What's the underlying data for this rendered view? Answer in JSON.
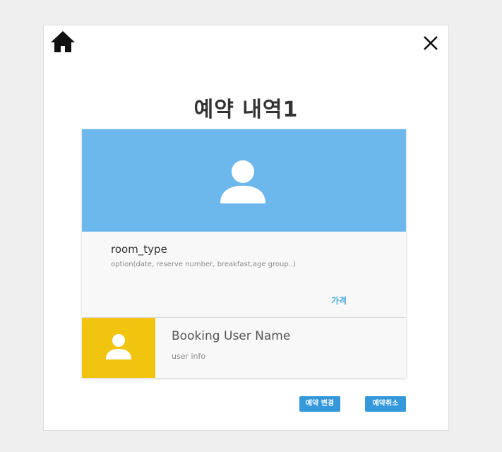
{
  "dialog": {
    "title": "예약 내역1"
  },
  "icons": {
    "home": "home-icon",
    "close": "close-icon",
    "room_image": "person-icon",
    "user_avatar": "person-icon"
  },
  "room": {
    "type": "room_type",
    "option": "option(date, reserve number, breakfast,age group..)",
    "price": "가격"
  },
  "user": {
    "name": "Booking User Name",
    "info": "user info"
  },
  "actions": {
    "change_label": "예약 변경",
    "cancel_label": "예약취소"
  },
  "colors": {
    "room_image_bg": "#6cb8ec",
    "avatar_bg": "#f1c40f",
    "button_bg": "#3498db",
    "price_text": "#4aa8d8"
  }
}
